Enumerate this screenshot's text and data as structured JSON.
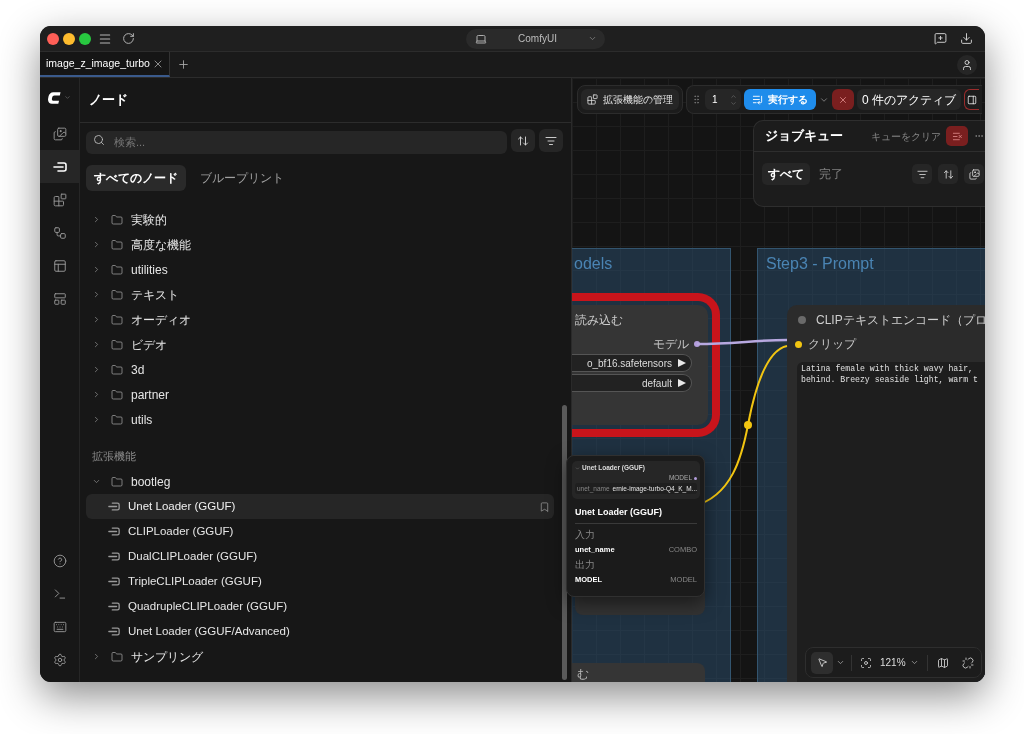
{
  "title_bar": {
    "app_name": "ComfyUI"
  },
  "tabs": [
    {
      "label": "image_z_image_turbo",
      "selected": true
    }
  ],
  "sidebar": {
    "items": [
      {
        "selected": false
      },
      {
        "selected": true
      },
      {
        "selected": false
      },
      {
        "selected": false
      },
      {
        "selected": false
      },
      {
        "selected": false
      }
    ]
  },
  "node_library": {
    "title": "ノード",
    "search": {
      "placeholder": "検索..."
    },
    "tabs": [
      {
        "label": "すべてのノード",
        "selected": true
      },
      {
        "label": "ブループリント",
        "selected": false
      }
    ],
    "tree": [
      {
        "kind": "folder",
        "label": "実験的",
        "expanded": false
      },
      {
        "kind": "folder",
        "label": "高度な機能",
        "expanded": false
      },
      {
        "kind": "folder",
        "label": "utilities",
        "expanded": false
      },
      {
        "kind": "folder",
        "label": "テキスト",
        "expanded": false
      },
      {
        "kind": "folder",
        "label": "オーディオ",
        "expanded": false
      },
      {
        "kind": "folder",
        "label": "ビデオ",
        "expanded": false
      },
      {
        "kind": "folder",
        "label": "3d",
        "expanded": false
      },
      {
        "kind": "folder",
        "label": "partner",
        "expanded": false
      },
      {
        "kind": "folder",
        "label": "utils",
        "expanded": false
      }
    ],
    "extensions": {
      "heading": "拡張機能",
      "tree": [
        {
          "kind": "folder",
          "label": "bootleg",
          "expanded": true,
          "children": [
            {
              "kind": "node",
              "label": "Unet Loader (GGUF)",
              "selected": true
            },
            {
              "kind": "node",
              "label": "CLIPLoader (GGUF)",
              "selected": false
            },
            {
              "kind": "node",
              "label": "DualCLIPLoader (GGUF)",
              "selected": false
            },
            {
              "kind": "node",
              "label": "TripleCLIPLoader (GGUF)",
              "selected": false
            },
            {
              "kind": "node",
              "label": "QuadrupleCLIPLoader (GGUF)",
              "selected": false
            },
            {
              "kind": "node",
              "label": "Unet Loader (GGUF/Advanced)",
              "selected": false
            }
          ]
        },
        {
          "kind": "folder",
          "label": "サンプリング",
          "expanded": false
        }
      ]
    }
  },
  "canvas": {
    "toolbar": {
      "extensions_button": "拡張機能の管理",
      "batch_count": "1",
      "run_button": "実行する",
      "active_jobs": "0 件のアクティブ"
    },
    "job_queue": {
      "title": "ジョブキュー",
      "clear_label": "キューをクリア",
      "filters": [
        {
          "label": "すべて",
          "selected": true
        },
        {
          "label": "完了",
          "selected": false
        }
      ]
    },
    "groups": [
      {
        "title": "odels"
      },
      {
        "title": "Step3 - Prompt"
      }
    ],
    "nodes": [
      {
        "kind": "loader",
        "title": "読み込む",
        "error": true,
        "outputs": [
          "モデル"
        ],
        "widgets": [
          "o_bf16.safetensors",
          "default"
        ]
      },
      {
        "kind": "text_encode",
        "title": "CLIPテキストエンコード（プロ",
        "error": false,
        "inputs": [
          "クリップ"
        ],
        "prompt_lines": [
          "Latina female with thick wavy hair,",
          "behind. Breezy seaside light, warm t"
        ]
      },
      {
        "kind": "stub",
        "title": "む",
        "error": false
      }
    ],
    "controls": {
      "pointer_selected": true,
      "zoom": "121%"
    }
  },
  "node_preview": {
    "mini": {
      "title": "Unet Loader (GGUF)",
      "output": "MODEL",
      "widget_label": "unet_name",
      "widget_value": "ernie-image-turbo-Q4_K_M..."
    },
    "title": "Unet Loader (GGUF)",
    "inputs_heading": "入力",
    "inputs": [
      {
        "name": "unet_name",
        "type": "COMBO"
      }
    ],
    "outputs_heading": "出力",
    "outputs": [
      {
        "name": "MODEL",
        "type": "MODEL"
      }
    ]
  }
}
